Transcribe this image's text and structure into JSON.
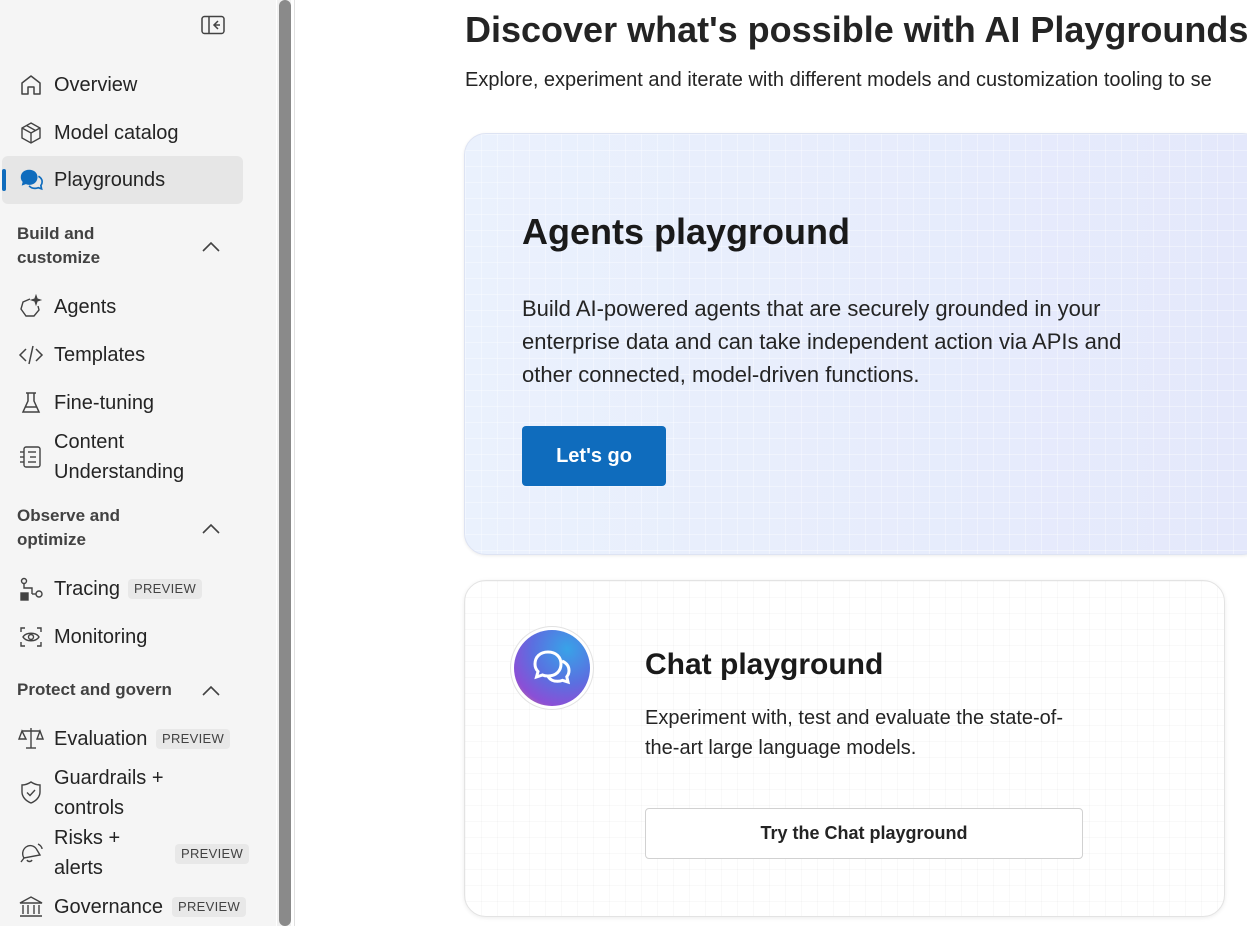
{
  "sidebar": {
    "collapse_label": "Collapse navigation",
    "top_items": [
      {
        "label": "Overview",
        "icon": "home-icon"
      },
      {
        "label": "Model catalog",
        "icon": "cube-icon"
      },
      {
        "label": "Playgrounds",
        "icon": "chat-bubbles-icon",
        "active": true
      }
    ],
    "sections": [
      {
        "title": "Build and customize",
        "expanded": true,
        "items": [
          {
            "label": "Agents",
            "icon": "agent-sparkle-icon"
          },
          {
            "label": "Templates",
            "icon": "code-icon"
          },
          {
            "label": "Fine-tuning",
            "icon": "beaker-icon"
          },
          {
            "label": "Content Understanding",
            "icon": "document-list-icon"
          }
        ]
      },
      {
        "title": "Observe and optimize",
        "expanded": true,
        "items": [
          {
            "label": "Tracing",
            "icon": "tracing-icon",
            "badge": "PREVIEW"
          },
          {
            "label": "Monitoring",
            "icon": "monitoring-eye-icon"
          }
        ]
      },
      {
        "title": "Protect and govern",
        "expanded": true,
        "items": [
          {
            "label": "Evaluation",
            "icon": "scales-icon",
            "badge": "PREVIEW"
          },
          {
            "label": "Guardrails + controls",
            "icon": "shield-check-icon"
          },
          {
            "label": "Risks + alerts",
            "icon": "alert-bell-icon",
            "badge": "PREVIEW"
          },
          {
            "label": "Governance",
            "icon": "building-bank-icon",
            "badge": "PREVIEW"
          }
        ]
      }
    ]
  },
  "main": {
    "title": "Discover what's possible with AI Playgrounds",
    "subtitle": "Explore, experiment and iterate with different models and customization tooling to se",
    "agents_card": {
      "title": "Agents playground",
      "description": "Build AI-powered agents that are securely grounded in your enterprise data and can take independent action via APIs and other connected, model-driven functions.",
      "button": "Let's go"
    },
    "chat_card": {
      "title": "Chat playground",
      "description": "Experiment with, test and evaluate the state-of-the-art large language models.",
      "button": "Try the Chat playground"
    }
  },
  "colors": {
    "accent": "#0f6cbd",
    "sidebar_bg": "#f5f5f5",
    "active_bg": "#e6e6e6"
  }
}
